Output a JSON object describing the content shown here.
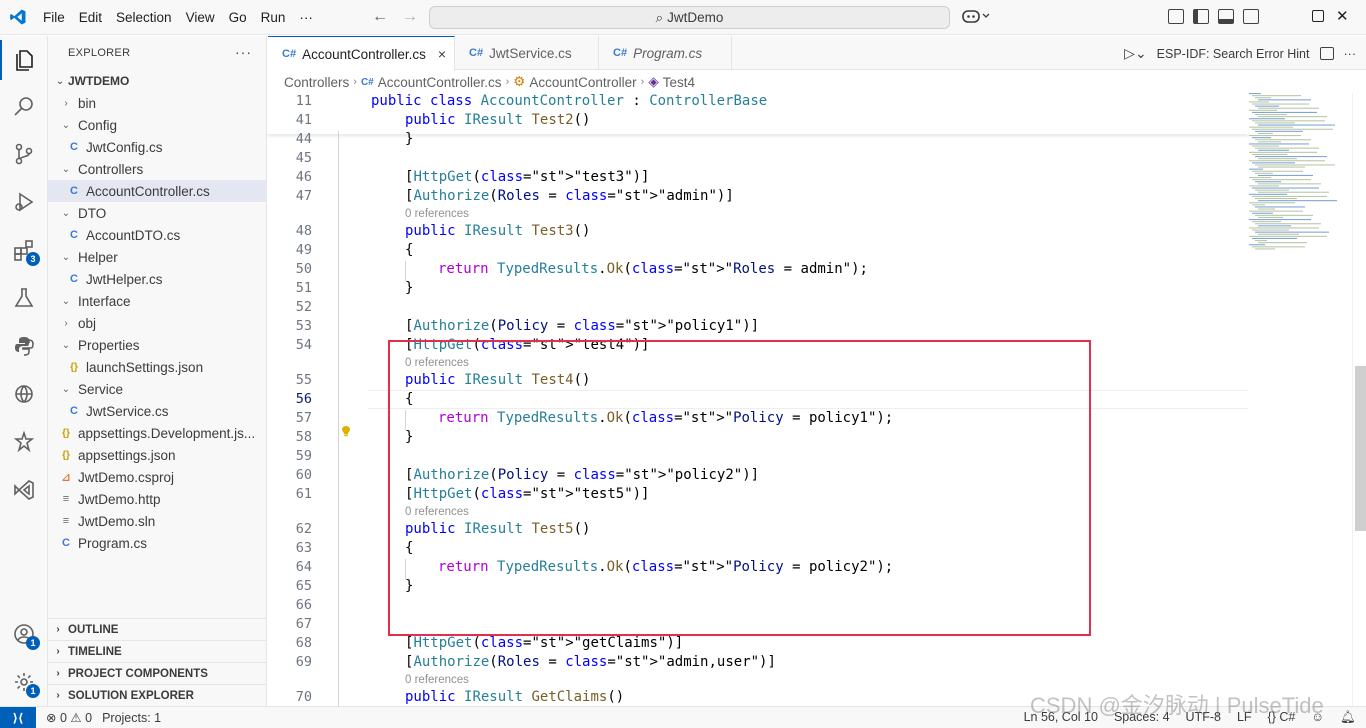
{
  "titlebar": {
    "menu": [
      "File",
      "Edit",
      "Selection",
      "View",
      "Go",
      "Run",
      "···"
    ],
    "command_center": "JwtDemo",
    "copilot_icon": "copilot-icon"
  },
  "activity_bar": {
    "extensions_badge": "3",
    "accounts_badge": "1",
    "settings_badge": "1"
  },
  "sidebar": {
    "title": "EXPLORER",
    "more": "···",
    "root": "JWTDEMO",
    "items": [
      {
        "label": "bin",
        "chev": "›",
        "icon": "",
        "indent": 1
      },
      {
        "label": "Config",
        "chev": "⌄",
        "icon": "",
        "indent": 1
      },
      {
        "label": "JwtConfig.cs",
        "chev": "",
        "icon": "C#",
        "indent": 2
      },
      {
        "label": "Controllers",
        "chev": "⌄",
        "icon": "",
        "indent": 1
      },
      {
        "label": "AccountController.cs",
        "chev": "",
        "icon": "C#",
        "indent": 2,
        "selected": true
      },
      {
        "label": "DTO",
        "chev": "⌄",
        "icon": "",
        "indent": 1
      },
      {
        "label": "AccountDTO.cs",
        "chev": "",
        "icon": "C#",
        "indent": 2
      },
      {
        "label": "Helper",
        "chev": "⌄",
        "icon": "",
        "indent": 1
      },
      {
        "label": "JwtHelper.cs",
        "chev": "",
        "icon": "C#",
        "indent": 2
      },
      {
        "label": "Interface",
        "chev": "⌄",
        "icon": "",
        "indent": 1
      },
      {
        "label": "obj",
        "chev": "›",
        "icon": "",
        "indent": 1
      },
      {
        "label": "Properties",
        "chev": "⌄",
        "icon": "",
        "indent": 1
      },
      {
        "label": "launchSettings.json",
        "chev": "",
        "icon": "{}",
        "indent": 2
      },
      {
        "label": "Service",
        "chev": "⌄",
        "icon": "",
        "indent": 1
      },
      {
        "label": "JwtService.cs",
        "chev": "",
        "icon": "C#",
        "indent": 2
      },
      {
        "label": "appsettings.Development.js...",
        "chev": "",
        "icon": "{}",
        "indent": 1
      },
      {
        "label": "appsettings.json",
        "chev": "",
        "icon": "{}",
        "indent": 1
      },
      {
        "label": "JwtDemo.csproj",
        "chev": "",
        "icon": "rss",
        "indent": 1
      },
      {
        "label": "JwtDemo.http",
        "chev": "",
        "icon": "≡",
        "indent": 1
      },
      {
        "label": "JwtDemo.sln",
        "chev": "",
        "icon": "≡",
        "indent": 1
      },
      {
        "label": "Program.cs",
        "chev": "",
        "icon": "C#",
        "indent": 1
      }
    ],
    "sections": [
      "OUTLINE",
      "TIMELINE",
      "PROJECT COMPONENTS",
      "SOLUTION EXPLORER"
    ]
  },
  "tabs": [
    {
      "label": "AccountController.cs",
      "active": true,
      "close": "×"
    },
    {
      "label": "JwtService.cs",
      "active": false
    },
    {
      "label": "Program.cs",
      "active": false,
      "preview": true
    }
  ],
  "tab_actions": {
    "hint_label": "ESP-IDF: Search Error Hint",
    "more": "···"
  },
  "breadcrumb": [
    "Controllers",
    "AccountController.cs",
    "AccountController",
    "Test4"
  ],
  "code": {
    "cursor_line": 56,
    "references_label": "0 references",
    "lines": [
      {
        "n": "11",
        "text": "public class AccountController : ControllerBase"
      },
      {
        "n": "41",
        "text": "public IResult Test2()"
      },
      {
        "n": "44",
        "text": "}"
      },
      {
        "n": "45",
        "text": ""
      },
      {
        "n": "46",
        "text": "[HttpGet(\"test3\")]"
      },
      {
        "n": "47",
        "text": "[Authorize(Roles = \"admin\")]"
      },
      {
        "n": "48",
        "text": "public IResult Test3()"
      },
      {
        "n": "49",
        "text": "{"
      },
      {
        "n": "50",
        "text": "return TypedResults.Ok(\"Roles = admin\");"
      },
      {
        "n": "51",
        "text": "}"
      },
      {
        "n": "52",
        "text": ""
      },
      {
        "n": "53",
        "text": "[Authorize(Policy = \"policy1\")]"
      },
      {
        "n": "54",
        "text": "[HttpGet(\"test4\")]"
      },
      {
        "n": "55",
        "text": "public IResult Test4()"
      },
      {
        "n": "56",
        "text": "{"
      },
      {
        "n": "57",
        "text": "return TypedResults.Ok(\"Policy = policy1\");"
      },
      {
        "n": "58",
        "text": "}"
      },
      {
        "n": "59",
        "text": ""
      },
      {
        "n": "60",
        "text": "[Authorize(Policy = \"policy2\")]"
      },
      {
        "n": "61",
        "text": "[HttpGet(\"test5\")]"
      },
      {
        "n": "62",
        "text": "public IResult Test5()"
      },
      {
        "n": "63",
        "text": "{"
      },
      {
        "n": "64",
        "text": "return TypedResults.Ok(\"Policy = policy2\");"
      },
      {
        "n": "65",
        "text": "}"
      },
      {
        "n": "66",
        "text": ""
      },
      {
        "n": "67",
        "text": ""
      },
      {
        "n": "68",
        "text": "[HttpGet(\"getClaims\")]"
      },
      {
        "n": "69",
        "text": "[Authorize(Roles = \"admin,user\")]"
      },
      {
        "n": "70",
        "text": "public IResult GetClaims()"
      }
    ]
  },
  "statusbar": {
    "errors": "0",
    "warnings": "0",
    "projects": "Projects: 1",
    "position": "Ln 56, Col 10",
    "spaces": "Spaces: 4",
    "encoding": "UTF-8",
    "eol": "LF",
    "language": "{} C#"
  },
  "watermark": "CSDN @金汐脉动 | PulseTide",
  "colors": {
    "accent": "#005fb8",
    "highlight_box": "#e0304e",
    "keyword": "#0000ff",
    "type": "#267f99",
    "string": "#a31515",
    "control": "#af00db"
  }
}
